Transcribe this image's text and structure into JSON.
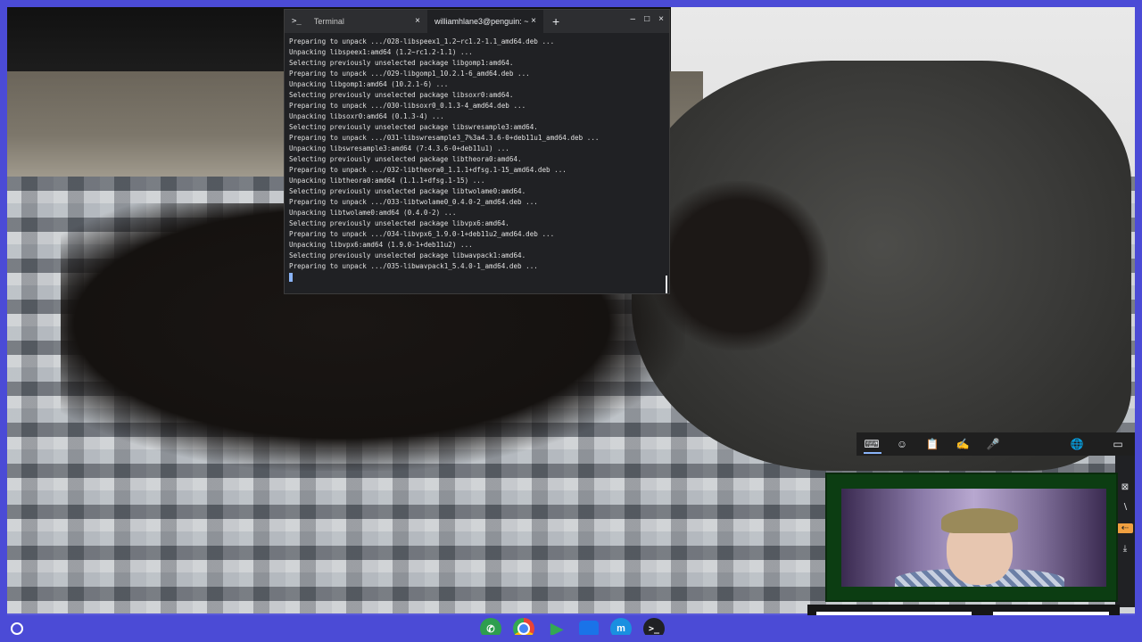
{
  "terminal": {
    "tabs": [
      {
        "label": "Terminal",
        "prompt": ">_",
        "active": false
      },
      {
        "label": "williamhlane3@penguin: ~",
        "active": true
      }
    ],
    "new_tab": "+",
    "controls": {
      "minimize": "–",
      "maximize": "□",
      "close": "×"
    },
    "tab_close": "×",
    "lines": [
      "Preparing to unpack .../028-libspeex1_1.2~rc1.2-1.1_amd64.deb ...",
      "Unpacking libspeex1:amd64 (1.2~rc1.2-1.1) ...",
      "Selecting previously unselected package libgomp1:amd64.",
      "Preparing to unpack .../029-libgomp1_10.2.1-6_amd64.deb ...",
      "Unpacking libgomp1:amd64 (10.2.1-6) ...",
      "Selecting previously unselected package libsoxr0:amd64.",
      "Preparing to unpack .../030-libsoxr0_0.1.3-4_amd64.deb ...",
      "Unpacking libsoxr0:amd64 (0.1.3-4) ...",
      "Selecting previously unselected package libswresample3:amd64.",
      "Preparing to unpack .../031-libswresample3_7%3a4.3.6-0+deb11u1_amd64.deb ...",
      "Unpacking libswresample3:amd64 (7:4.3.6-0+deb11u1) ...",
      "Selecting previously unselected package libtheora0:amd64.",
      "Preparing to unpack .../032-libtheora0_1.1.1+dfsg.1-15_amd64.deb ...",
      "Unpacking libtheora0:amd64 (1.1.1+dfsg.1-15) ...",
      "Selecting previously unselected package libtwolame0:amd64.",
      "Preparing to unpack .../033-libtwolame0_0.4.0-2_amd64.deb ...",
      "Unpacking libtwolame0:amd64 (0.4.0-2) ...",
      "Selecting previously unselected package libvpx6:amd64.",
      "Preparing to unpack .../034-libvpx6_1.9.0-1+deb11u2_amd64.deb ...",
      "Unpacking libvpx6:amd64 (1.9.0-1+deb11u2) ...",
      "Selecting previously unselected package libwavpack1:amd64.",
      "Preparing to unpack .../035-libwavpack1_5.4.0-1_amd64.deb ..."
    ]
  },
  "keyboard_toolbar": {
    "icons": [
      "keyboard-icon",
      "emoji-icon",
      "clipboard-icon",
      "handwriting-icon",
      "microphone-icon",
      "globe-icon",
      "dock-icon"
    ],
    "glyphs": [
      "⌨",
      "☺",
      "📋",
      "✍",
      "🎤",
      "🌐",
      "▭"
    ],
    "side": [
      "⊠",
      "∖",
      "⇠",
      "⤓"
    ]
  },
  "shelf": {
    "apps": [
      {
        "name": "phone-hub",
        "glyph": "✆"
      },
      {
        "name": "chrome",
        "glyph": ""
      },
      {
        "name": "play-store",
        "glyph": "▶"
      },
      {
        "name": "files",
        "glyph": ""
      },
      {
        "name": "messages",
        "glyph": "m"
      },
      {
        "name": "terminal",
        "glyph": ">_"
      }
    ]
  },
  "colors": {
    "frame": "#4b4bd6",
    "terminal_bg": "#202124",
    "accent": "#8ab4f8",
    "webcam_border": "#0c3d12"
  }
}
